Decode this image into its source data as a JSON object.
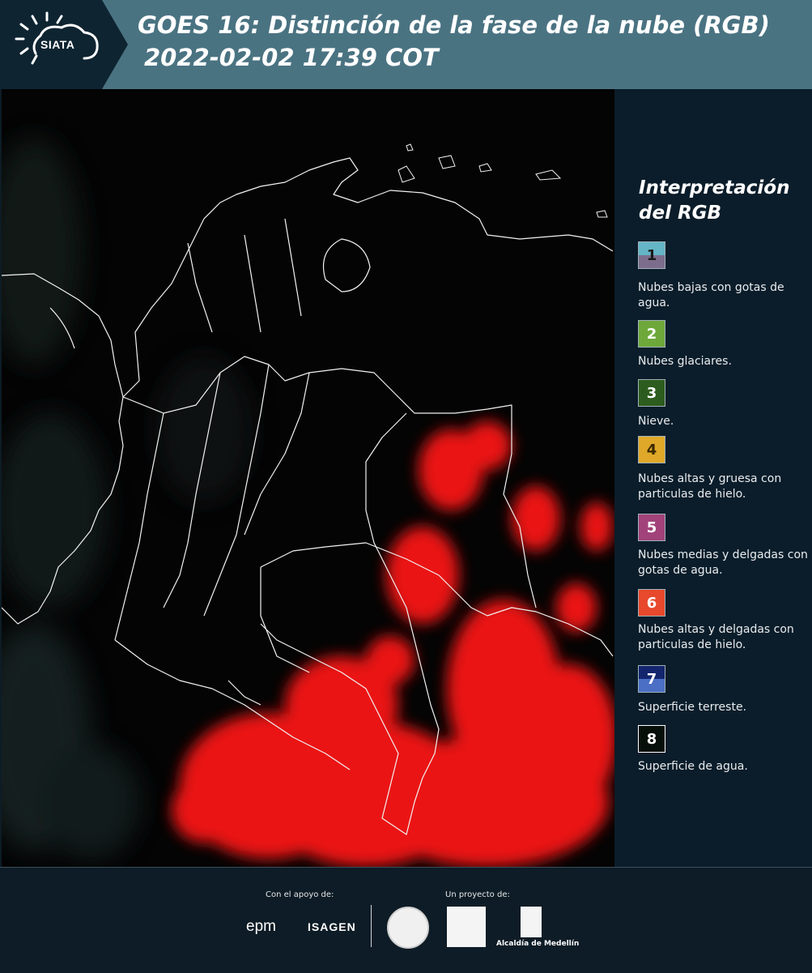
{
  "header": {
    "logo_text": "SIATA",
    "title_line1": "GOES 16: Distinción de la fase de la nube (RGB)",
    "title_line2": "2022-02-02 17:39 COT"
  },
  "legend": {
    "title": "Interpretación del RGB",
    "items": [
      {
        "number": "1",
        "label": "Nubes bajas con gotas de agua.",
        "color_top": "#64b5c6",
        "color_bottom": "#7d6d8c"
      },
      {
        "number": "2",
        "label": "Nubes glaciares.",
        "color": "#6ea83a"
      },
      {
        "number": "3",
        "label": "Nieve.",
        "color": "#2d5d1e"
      },
      {
        "number": "4",
        "label": "Nubes altas y gruesa con particulas de hielo.",
        "color": "#e0a829"
      },
      {
        "number": "5",
        "label": "Nubes medias y delgadas con gotas de agua.",
        "color": "#a1437a"
      },
      {
        "number": "6",
        "label": "Nubes altas y delgadas con particulas de hielo.",
        "color": "#e8492c"
      },
      {
        "number": "7",
        "label": "Superficie terreste.",
        "color_top": "#13266d",
        "color_bottom": "#4a6fc4"
      },
      {
        "number": "8",
        "label": "Superficie de agua.",
        "color": "#060f08"
      }
    ]
  },
  "footer": {
    "support_label": "Con el apoyo de:",
    "project_label": "Un proyecto de:",
    "epm": "epm",
    "isagen": "ISAGEN",
    "alcaldia": "Alcaldía de Medellín"
  },
  "colors": {
    "header_bg": "#4a7382",
    "legend_bg": "#0b1d2a",
    "cloud_red": "#ff1a1a"
  }
}
